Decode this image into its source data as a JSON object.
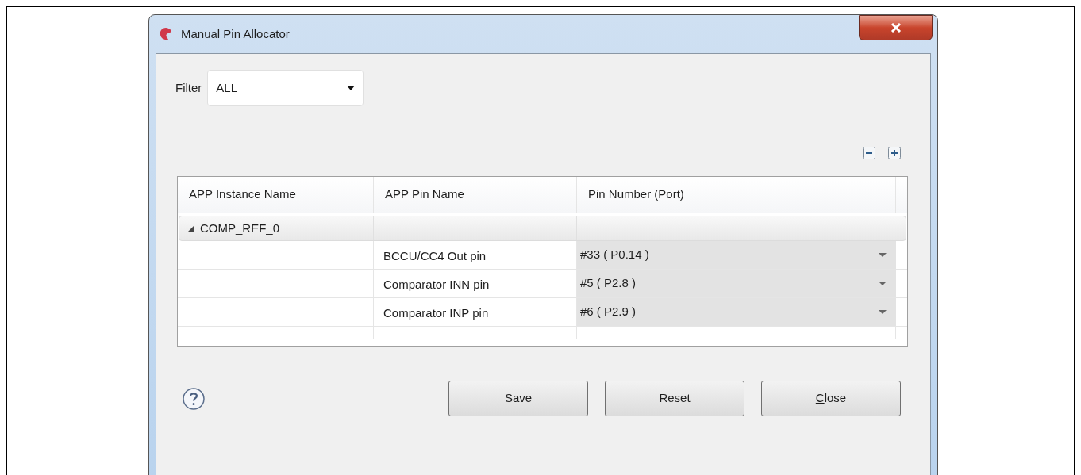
{
  "window": {
    "title": "Manual Pin Allocator"
  },
  "filter": {
    "label": "Filter",
    "value": "ALL"
  },
  "table": {
    "columns": [
      "APP Instance Name",
      "APP Pin Name",
      "Pin Number (Port)"
    ],
    "groups": [
      {
        "name": "COMP_REF_0",
        "expanded": true,
        "children": [
          {
            "pin_name": "BCCU/CC4 Out pin",
            "pin_number": "#33 ( P0.14 )"
          },
          {
            "pin_name": "Comparator INN pin",
            "pin_number": "#5 ( P2.8 )"
          },
          {
            "pin_name": "Comparator INP pin",
            "pin_number": "#6 ( P2.9 )"
          }
        ]
      }
    ]
  },
  "buttons": [
    "Save",
    "Reset",
    "Close"
  ]
}
